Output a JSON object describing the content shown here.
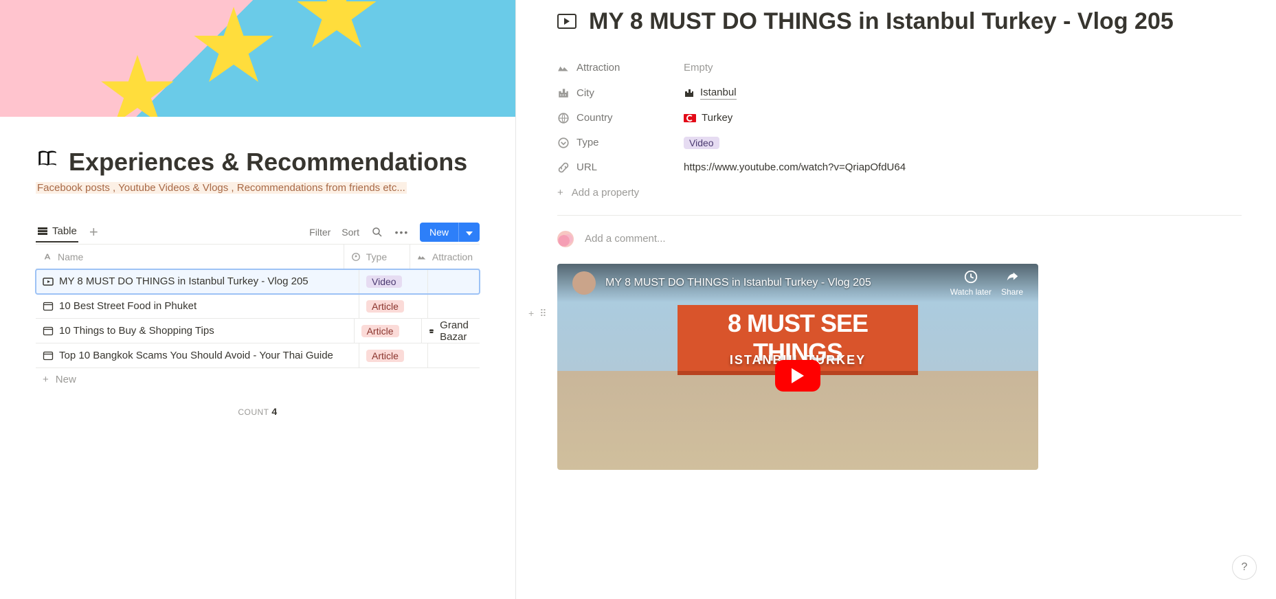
{
  "page": {
    "title": "Experiences & Recommendations",
    "subtitle": "Facebook posts , Youtube Videos & Vlogs , Recommendations from friends etc...",
    "view_tab": "Table",
    "controls": {
      "filter": "Filter",
      "sort": "Sort",
      "new": "New"
    },
    "columns": {
      "name": "Name",
      "type": "Type",
      "attr": "Attraction"
    },
    "rows": [
      {
        "icon": "video",
        "name": "MY 8 MUST DO THINGS in Istanbul Turkey - Vlog 205",
        "type": "Video",
        "type_class": "video",
        "attr": "",
        "selected": true
      },
      {
        "icon": "web",
        "name": "10 Best Street Food in Phuket",
        "type": "Article",
        "type_class": "article",
        "attr": "",
        "selected": false
      },
      {
        "icon": "web",
        "name": "10 Things to Buy & Shopping Tips",
        "type": "Article",
        "type_class": "article",
        "attr": "Grand Bazar",
        "selected": false
      },
      {
        "icon": "web",
        "name": "Top 10 Bangkok Scams You Should Avoid - Your Thai Guide",
        "type": "Article",
        "type_class": "article",
        "attr": "",
        "selected": false
      }
    ],
    "new_row": "New",
    "count_label": "COUNT",
    "count_value": "4"
  },
  "detail": {
    "title": "MY 8 MUST DO THINGS in Istanbul Turkey - Vlog 205",
    "props": {
      "attraction": {
        "label": "Attraction",
        "value": "Empty"
      },
      "city": {
        "label": "City",
        "value": "Istanbul"
      },
      "country": {
        "label": "Country",
        "value": "Turkey"
      },
      "type": {
        "label": "Type",
        "value": "Video"
      },
      "url": {
        "label": "URL",
        "value": "https://www.youtube.com/watch?v=QriapOfdU64"
      }
    },
    "add_property": "Add a property",
    "comment_placeholder": "Add a comment...",
    "embed": {
      "yt_title": "MY 8 MUST DO THINGS in Istanbul Turkey - Vlog 205",
      "watch_later": "Watch later",
      "share": "Share",
      "banner": "8 MUST SEE THINGS",
      "sub": "ISTANBUL TURKEY"
    }
  },
  "help": "?"
}
